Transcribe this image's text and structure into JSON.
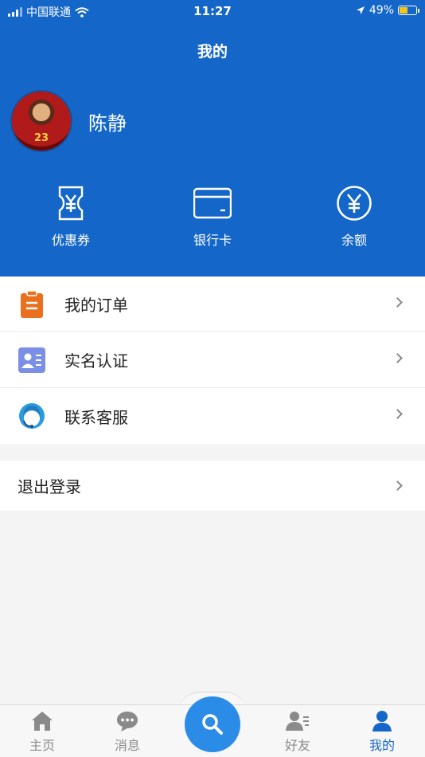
{
  "status": {
    "carrier": "中国联通",
    "time": "11:27",
    "battery": "49%"
  },
  "title": "我的",
  "user": {
    "name": "陈静",
    "avatar_text": "23"
  },
  "wallet": [
    {
      "label": "优惠券",
      "icon": "coupon-icon"
    },
    {
      "label": "银行卡",
      "icon": "bank-card-icon"
    },
    {
      "label": "余额",
      "icon": "yen-coin-icon"
    }
  ],
  "menu": [
    {
      "label": "我的订单",
      "icon": "clipboard-icon",
      "color": "#e8701e"
    },
    {
      "label": "实名认证",
      "icon": "id-card-icon",
      "color": "#7b8fe6"
    },
    {
      "label": "联系客服",
      "icon": "customer-service-icon",
      "color": "#2a9be0"
    }
  ],
  "logout": {
    "label": "退出登录"
  },
  "tabs": [
    {
      "label": "主页",
      "icon": "home-icon"
    },
    {
      "label": "消息",
      "icon": "message-icon"
    },
    {
      "label": "好友",
      "icon": "friends-icon"
    },
    {
      "label": "我的",
      "icon": "user-icon"
    }
  ],
  "colors": {
    "primary": "#1467c8",
    "search": "#2b8ce8"
  }
}
